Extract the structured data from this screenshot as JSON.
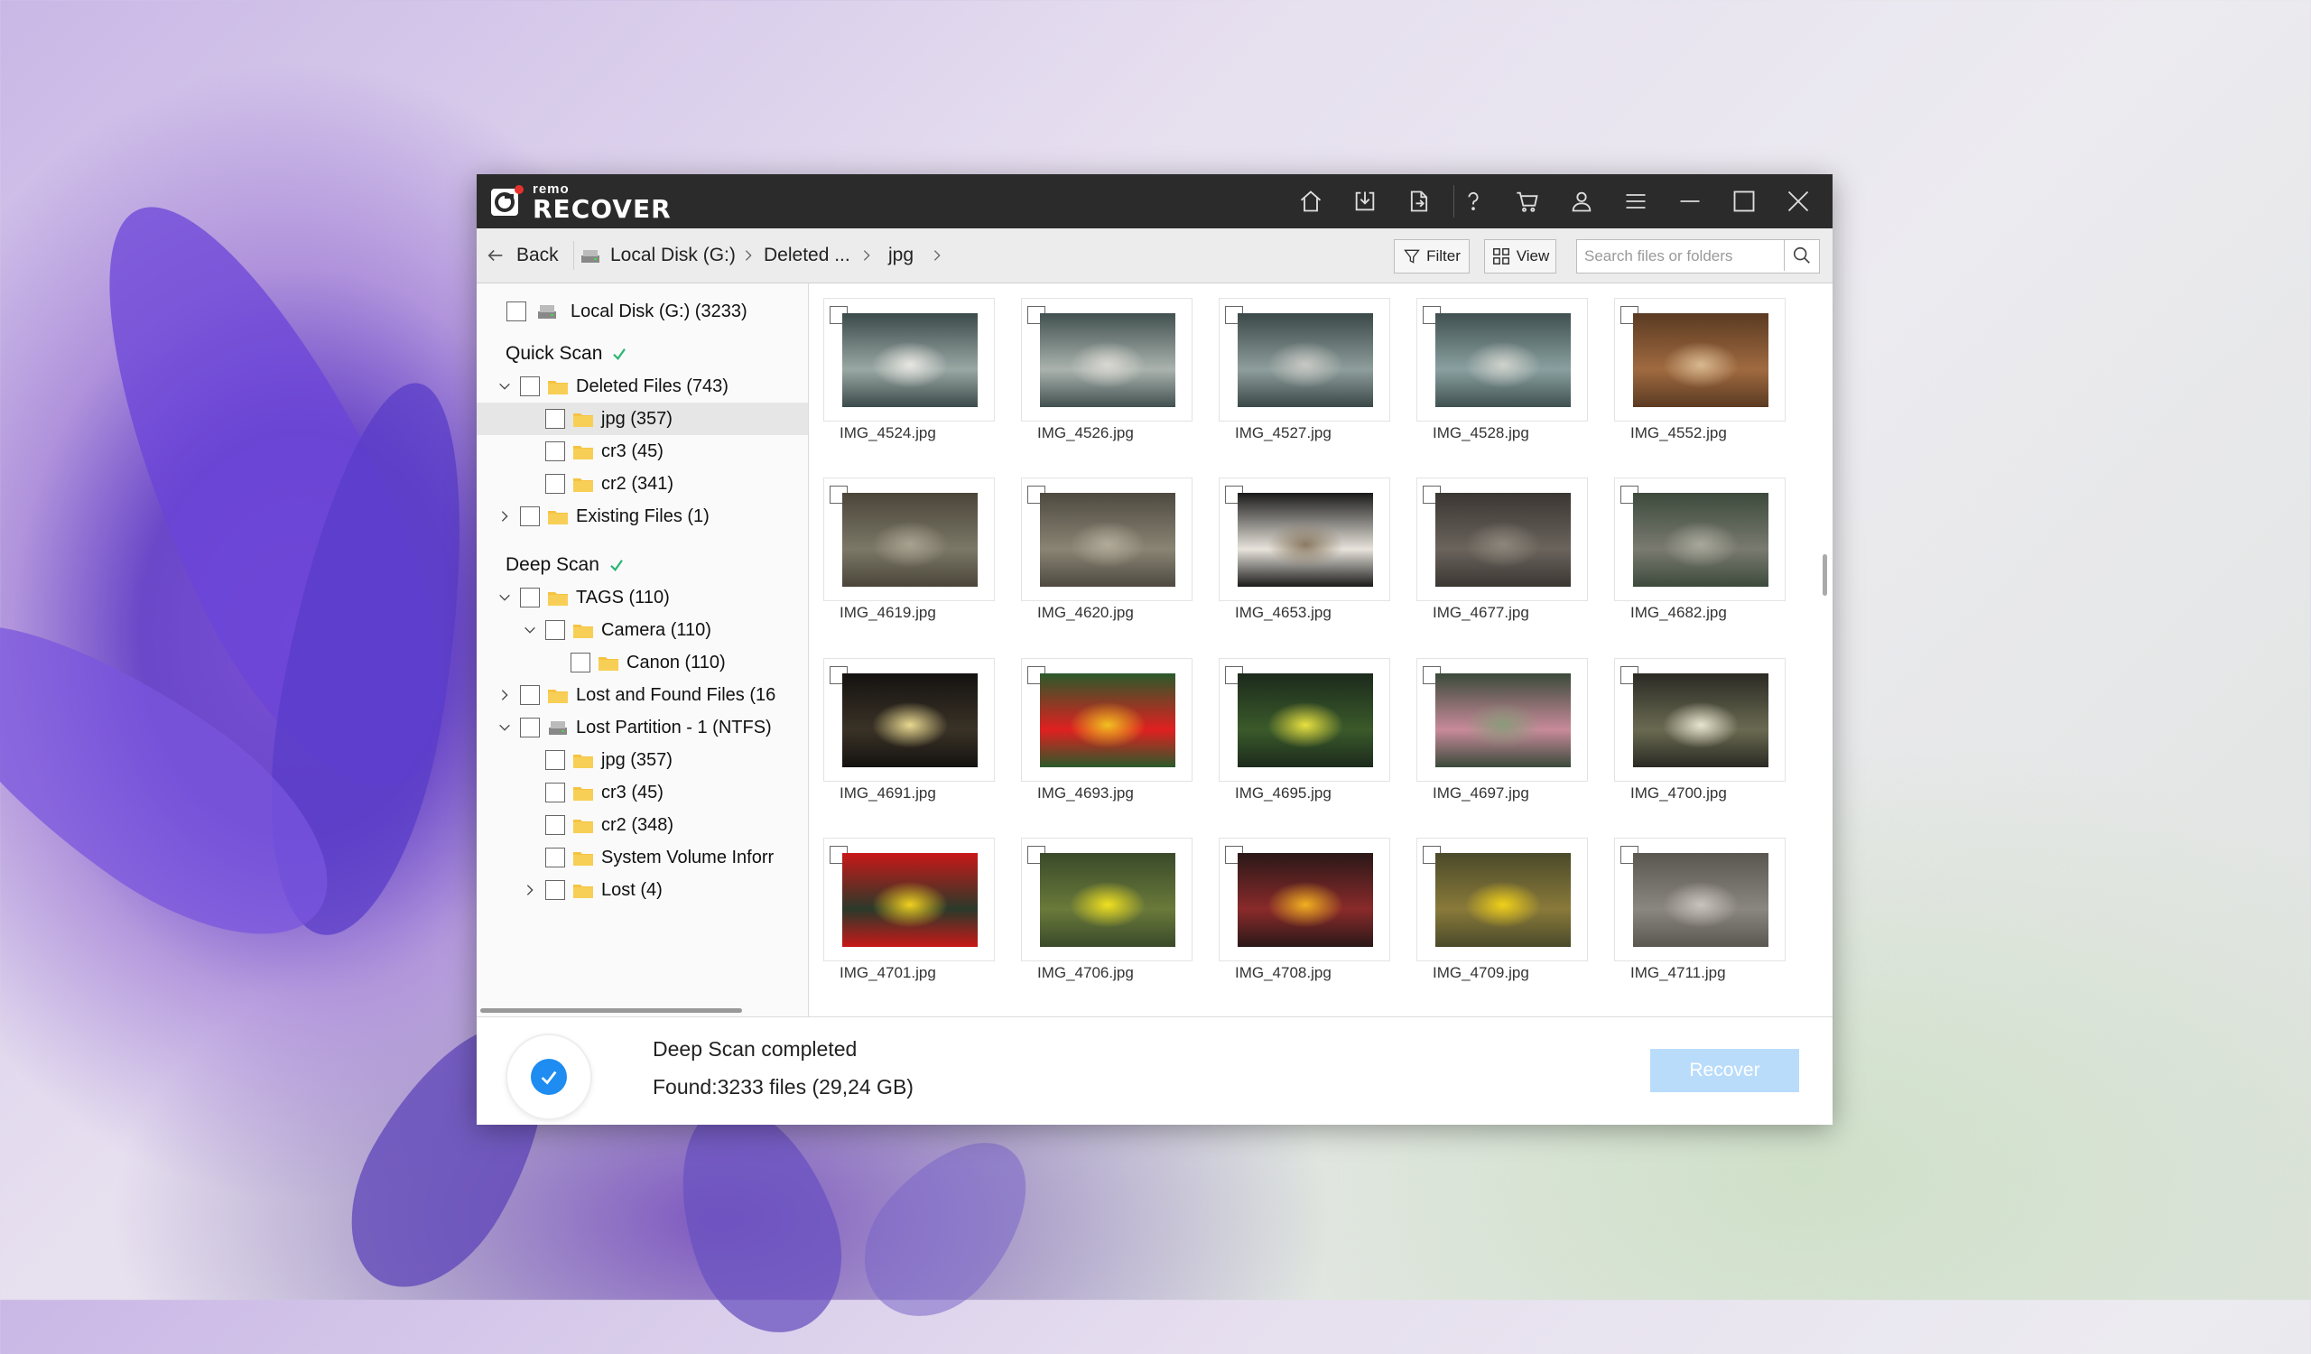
{
  "app": {
    "brand_small": "remo",
    "brand_large": "RECOVER"
  },
  "toolbar": {
    "icons": [
      "home-icon",
      "download-icon",
      "export-icon",
      "help-icon",
      "cart-icon",
      "account-icon",
      "menu-icon",
      "minimize-icon",
      "maximize-icon",
      "close-icon"
    ]
  },
  "nav": {
    "back_label": "Back",
    "crumbs": [
      "Local Disk (G:)",
      "Deleted ...",
      "jpg"
    ],
    "filter_label": "Filter",
    "view_label": "View",
    "search_placeholder": "Search files or folders"
  },
  "tree": {
    "root": "Local Disk (G:) (3233)",
    "quick_scan": "Quick Scan",
    "deep_scan": "Deep Scan",
    "items": [
      {
        "label": "Deleted Files (743)",
        "depth": 1,
        "chevron": "down",
        "icon": "folder"
      },
      {
        "label": "jpg (357)",
        "depth": 2,
        "chevron": "",
        "icon": "folder",
        "selected": true
      },
      {
        "label": "cr3 (45)",
        "depth": 2,
        "chevron": "",
        "icon": "folder"
      },
      {
        "label": "cr2 (341)",
        "depth": 2,
        "chevron": "",
        "icon": "folder"
      },
      {
        "label": "Existing Files (1)",
        "depth": 1,
        "chevron": "right",
        "icon": "folder"
      },
      {
        "label": "TAGS (110)",
        "depth": 1,
        "chevron": "down",
        "icon": "folder"
      },
      {
        "label": "Camera (110)",
        "depth": 2,
        "chevron": "down",
        "icon": "folder"
      },
      {
        "label": "Canon (110)",
        "depth": 3,
        "chevron": "",
        "icon": "folder"
      },
      {
        "label": "Lost and Found Files (16",
        "depth": 1,
        "chevron": "right",
        "icon": "folder"
      },
      {
        "label": "Lost Partition - 1 (NTFS)",
        "depth": 1,
        "chevron": "down",
        "icon": "drive"
      },
      {
        "label": "jpg (357)",
        "depth": 2,
        "chevron": "",
        "icon": "folder"
      },
      {
        "label": "cr3 (45)",
        "depth": 2,
        "chevron": "",
        "icon": "folder"
      },
      {
        "label": "cr2 (348)",
        "depth": 2,
        "chevron": "",
        "icon": "folder"
      },
      {
        "label": "System Volume Inforr",
        "depth": 2,
        "chevron": "",
        "icon": "folder"
      },
      {
        "label": "Lost (4)",
        "depth": 2,
        "chevron": "right",
        "icon": "folder"
      }
    ]
  },
  "files": [
    {
      "name": "IMG_4524.jpg",
      "c1": "#3b4a4a",
      "c2": "#9aa8a4",
      "c3": "#e8e6e2"
    },
    {
      "name": "IMG_4526.jpg",
      "c1": "#41504f",
      "c2": "#aab3ae",
      "c3": "#dad8d2"
    },
    {
      "name": "IMG_4527.jpg",
      "c1": "#3a4848",
      "c2": "#8e9e9c",
      "c3": "#c8c8c4"
    },
    {
      "name": "IMG_4528.jpg",
      "c1": "#405050",
      "c2": "#8aa0a0",
      "c3": "#d0d2cc"
    },
    {
      "name": "IMG_4552.jpg",
      "c1": "#5a3a22",
      "c2": "#a06a40",
      "c3": "#d8b890"
    },
    {
      "name": "IMG_4619.jpg",
      "c1": "#4a4538",
      "c2": "#7c7868",
      "c3": "#a8a290"
    },
    {
      "name": "IMG_4620.jpg",
      "c1": "#4e4a40",
      "c2": "#8a8474",
      "c3": "#b2ab9a"
    },
    {
      "name": "IMG_4653.jpg",
      "c1": "#1a1a1a",
      "c2": "#e8e4dc",
      "c3": "#8a7a62"
    },
    {
      "name": "IMG_4677.jpg",
      "c1": "#3a3632",
      "c2": "#6a645c",
      "c3": "#8c867c"
    },
    {
      "name": "IMG_4682.jpg",
      "c1": "#3c4a3c",
      "c2": "#7a7a70",
      "c3": "#a8a89c"
    },
    {
      "name": "IMG_4691.jpg",
      "c1": "#141210",
      "c2": "#3a3226",
      "c3": "#e8d890"
    },
    {
      "name": "IMG_4693.jpg",
      "c1": "#2a5a2a",
      "c2": "#e02020",
      "c3": "#f0c020"
    },
    {
      "name": "IMG_4695.jpg",
      "c1": "#1c2a1c",
      "c2": "#3a5a2a",
      "c3": "#e8e040"
    },
    {
      "name": "IMG_4697.jpg",
      "c1": "#3a4a3a",
      "c2": "#c88a9a",
      "c3": "#8a9a7a"
    },
    {
      "name": "IMG_4700.jpg",
      "c1": "#2a2a24",
      "c2": "#6a6a52",
      "c3": "#e8e4d0"
    },
    {
      "name": "IMG_4701.jpg",
      "c1": "#c81818",
      "c2": "#2a3a2a",
      "c3": "#f0d020"
    },
    {
      "name": "IMG_4706.jpg",
      "c1": "#3a4a2a",
      "c2": "#6a7a3a",
      "c3": "#f0e020"
    },
    {
      "name": "IMG_4708.jpg",
      "c1": "#2a1818",
      "c2": "#8a2a2a",
      "c3": "#f0b020"
    },
    {
      "name": "IMG_4709.jpg",
      "c1": "#4a4a2a",
      "c2": "#8a7a3a",
      "c3": "#f0d018"
    },
    {
      "name": "IMG_4711.jpg",
      "c1": "#5a5650",
      "c2": "#8a8680",
      "c3": "#c8c4bc"
    }
  ],
  "status": {
    "title": "Deep Scan completed",
    "found": "Found:3233 files (29,24 GB)",
    "recover_label": "Recover"
  },
  "colors": {
    "accent": "#1e8cf0",
    "check": "#2bb673",
    "folder": "#f5c342",
    "titlebar": "#2b2b2b"
  }
}
